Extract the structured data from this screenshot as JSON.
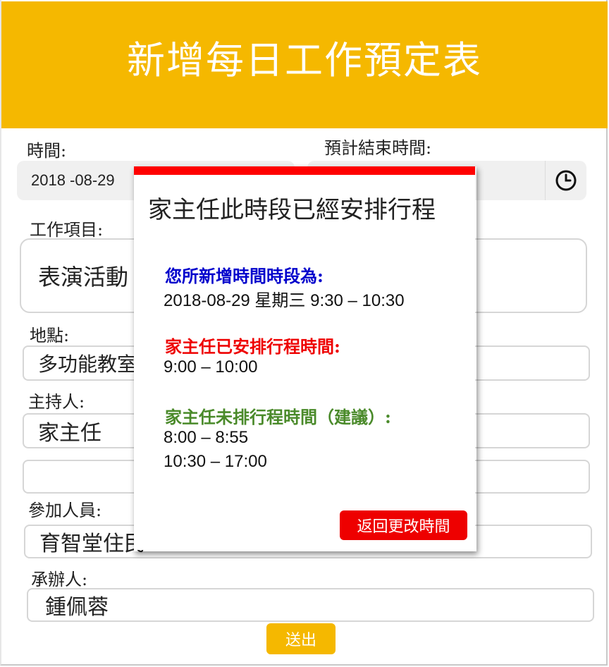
{
  "header": {
    "title": "新增每日工作預定表"
  },
  "form": {
    "time_label": "時間:",
    "time_value": "2018 -08-29",
    "end_time_label": "預計結束時間:",
    "work_item_label": "工作項目:",
    "work_item_value": "表演活動",
    "location_label": "地點:",
    "location_value": "多功能教室",
    "host_label": "主持人:",
    "host_value": "家主任",
    "extra_value": "",
    "participants_label": "參加人員:",
    "participants_value": "育智堂住民",
    "organizer_label": "承辦人:",
    "organizer_value": "鍾佩蓉",
    "submit_label": "送出"
  },
  "dialog": {
    "title": "家主任此時段已經安排行程",
    "new_slot_heading": "您所新增時間時段為:",
    "new_slot_value": "2018-08-29 星期三 9:30 – 10:30",
    "booked_heading": "家主任已安排行程時間:",
    "booked_value": "9:00 – 10:00",
    "free_heading": "家主任未排行程時間（建議）:",
    "free_values": [
      "8:00 – 8:55",
      "10:30 – 17:00"
    ],
    "back_button": "返回更改時間"
  },
  "icons": {
    "clock": "clock-icon"
  },
  "colors": {
    "brand": "#f5b800",
    "alert": "#ff0000",
    "blue": "#0000cc",
    "red": "#ee0000",
    "green": "#4a8a2a"
  }
}
